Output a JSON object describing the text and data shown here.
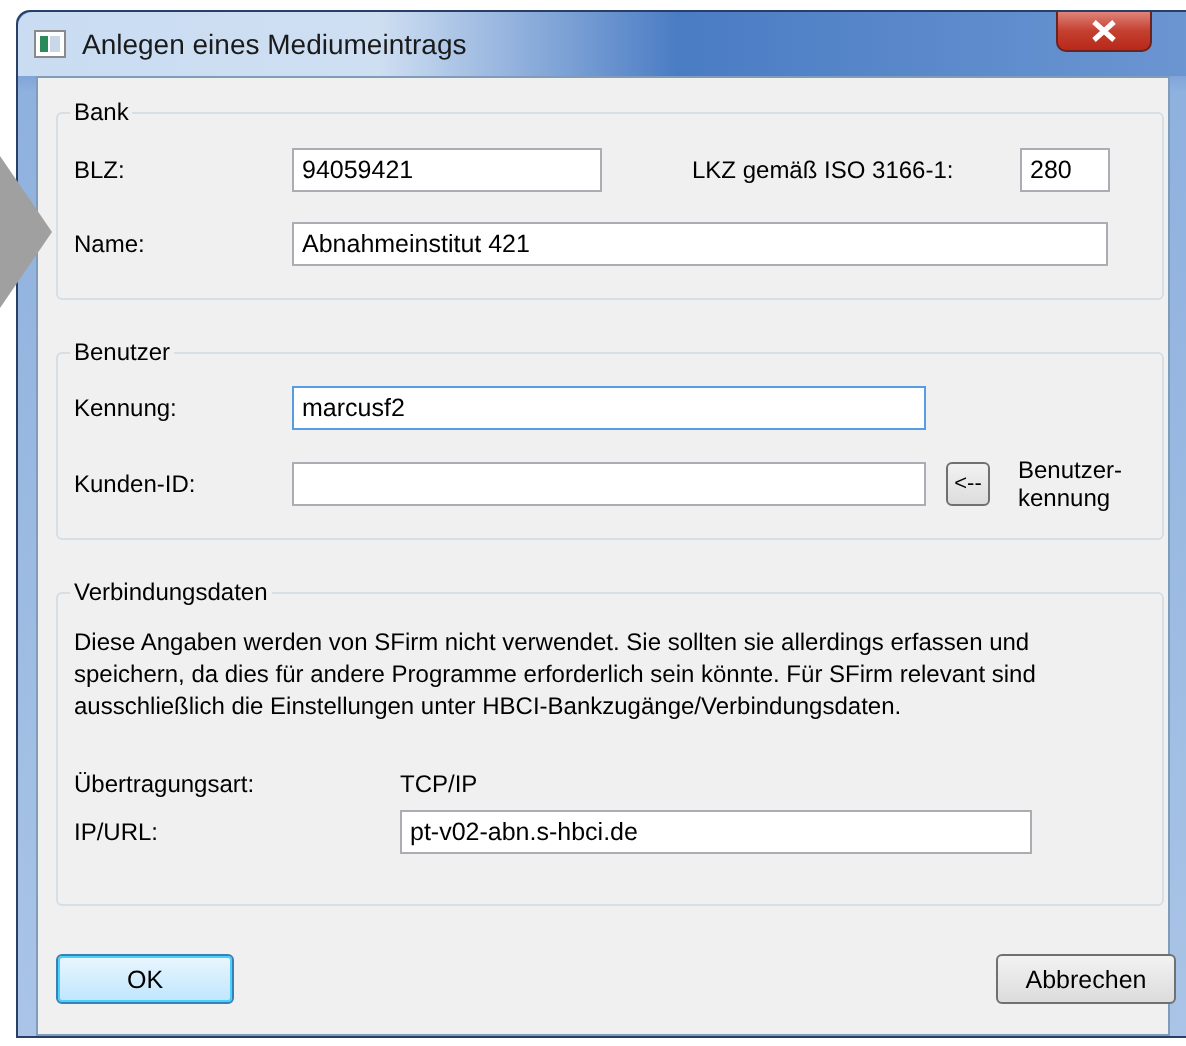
{
  "window": {
    "title": "Anlegen eines Mediumeintrags"
  },
  "bank": {
    "legend": "Bank",
    "fields": [
      {
        "label": "BLZ:",
        "value": "94059421",
        "focused": false
      },
      {
        "label": "LKZ gemäß ISO 3166-1:",
        "value": "280",
        "focused": false
      },
      {
        "label": "Name:",
        "value": "Abnahmeinstitut 421",
        "focused": false
      }
    ]
  },
  "benutzer": {
    "legend": "Benutzer",
    "fields": [
      {
        "label": "Kennung:",
        "value": "marcusf2",
        "focused": true
      },
      {
        "label": "Kunden-ID:",
        "focused": false
      }
    ],
    "copy_button": "<--",
    "copy_label": [
      "Benutzer-",
      "kennung"
    ]
  },
  "verbindung": {
    "legend": "Verbindungsdaten",
    "note": "Diese Angaben werden von SFirm nicht verwendet. Sie sollten sie allerdings erfassen und speichern, da dies für andere Programme erforderlich sein könnte. Für SFirm relevant sind ausschließlich die Einstellungen unter HBCI-Bankzugänge/Verbindungsdaten.",
    "transfer_label": "Übertragungsart:",
    "transfer_value": "TCP/IP",
    "url_label": "IP/URL:",
    "url": "pt-v02-abn.s-hbci.de"
  },
  "buttons": [
    {
      "label": "OK",
      "default": true
    },
    {
      "label": "Abbrechen",
      "default": false
    }
  ]
}
